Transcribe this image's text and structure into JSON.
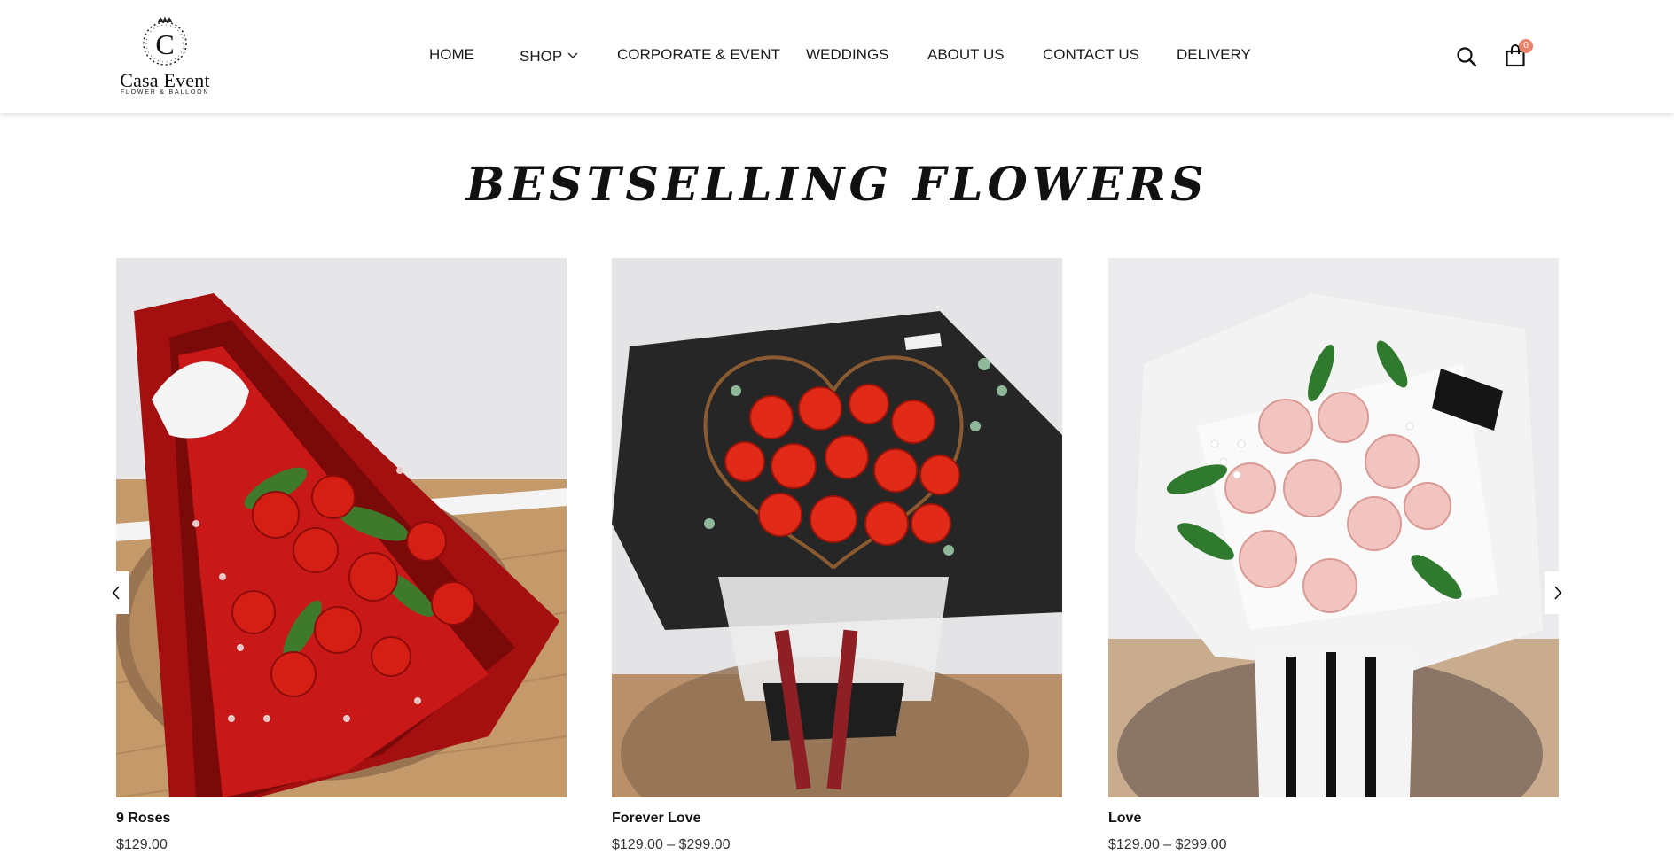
{
  "brand": {
    "monogram": "C",
    "name": "Casa Event",
    "tagline": "FLOWER & BALLOON"
  },
  "nav": {
    "items": [
      {
        "label": "HOME"
      },
      {
        "label": "SHOP",
        "has_dropdown": true
      },
      {
        "label": "CORPORATE & EVENT"
      },
      {
        "label": "WEDDINGS"
      },
      {
        "label": "ABOUT US"
      },
      {
        "label": "CONTACT US"
      },
      {
        "label": "DELIVERY"
      }
    ]
  },
  "header_icons": {
    "search_icon": "search-icon",
    "cart_icon": "shopping-bag-icon",
    "cart_count": "0"
  },
  "section": {
    "title": "BESTSELLING FLOWERS"
  },
  "carousel": {
    "prev_icon": "chevron-left-icon",
    "next_icon": "chevron-right-icon"
  },
  "products": [
    {
      "name": "9 Roses",
      "price": "$129.00",
      "image": "red-rose-bouquet-photo"
    },
    {
      "name": "Forever Love",
      "price": "$129.00 – $299.00",
      "image": "heart-rose-bouquet-photo"
    },
    {
      "name": "Love",
      "price": "$129.00 – $299.00",
      "image": "pink-rose-bouquet-photo"
    }
  ],
  "colors": {
    "accent": "#e8836b",
    "text": "#111111",
    "rose_red": "#d61f14",
    "rose_pink": "#f2c4c0"
  }
}
